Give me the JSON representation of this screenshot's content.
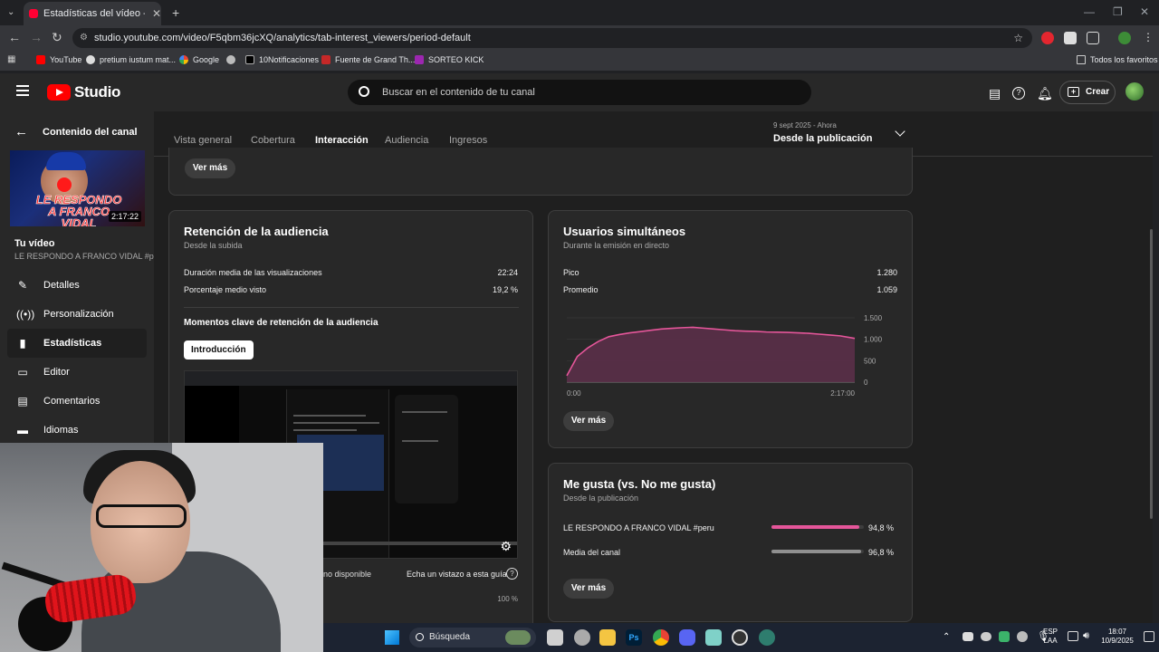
{
  "browser": {
    "tab_title": "Estadísticas del vídeo - YouTube",
    "url": "studio.youtube.com/video/F5qbm36jcXQ/analytics/tab-interest_viewers/period-default",
    "bookmarks": [
      "YouTube",
      "pretium iustum mat...",
      "Google",
      "10Notificaciones",
      "Fuente de Grand Th...",
      "SORTEO KICK"
    ],
    "all_bookmarks": "Todos los favoritos"
  },
  "header": {
    "logo_text": "Studio",
    "search_placeholder": "Buscar en el contenido de tu canal",
    "create_label": "Crear"
  },
  "sidebar": {
    "back_label": "Contenido del canal",
    "thumb_caption": "LE RESPONDO A FRANCO VIDAL",
    "duration": "2:17:22",
    "your_video": "Tu vídeo",
    "video_title": "LE RESPONDO A FRANCO VIDAL #p...",
    "items": [
      {
        "label": "Detalles",
        "icon": "pencil-icon"
      },
      {
        "label": "Personalización",
        "icon": "broadcast-icon"
      },
      {
        "label": "Estadísticas",
        "icon": "bar-chart-icon"
      },
      {
        "label": "Editor",
        "icon": "editor-icon"
      },
      {
        "label": "Comentarios",
        "icon": "comment-icon"
      },
      {
        "label": "Idiomas",
        "icon": "subtitles-icon"
      }
    ]
  },
  "tabs": [
    "Vista general",
    "Cobertura",
    "Interacción",
    "Audiencia",
    "Ingresos"
  ],
  "period": {
    "date_range": "9 sept 2025 - Ahora",
    "label": "Desde la publicación"
  },
  "top_card": {
    "more": "Ver más"
  },
  "retention": {
    "title": "Retención de la audiencia",
    "subtitle": "Desde la subida",
    "avg_duration_label": "Duración media de las visualizaciones",
    "avg_duration_value": "22:24",
    "avg_pct_label": "Porcentaje medio visto",
    "avg_pct_value": "19,2 %",
    "moments_title": "Momentos clave de retención de la audiencia",
    "intro_chip": "Introducción",
    "unavailable": "no disponible",
    "guide_link": "Echa un vistazo a esta guía",
    "pct_tick": "100 %"
  },
  "concurrent": {
    "title": "Usuarios simultáneos",
    "subtitle": "Durante la emisión en directo",
    "peak_label": "Pico",
    "peak_value": "1.280",
    "avg_label": "Promedio",
    "avg_value": "1.059",
    "more": "Ver más",
    "chart_data": {
      "type": "area",
      "y_ticks": [
        "1.500",
        "1.000",
        "500",
        "0"
      ],
      "x_ticks": [
        "0:00",
        "2:17:00"
      ],
      "ylim": [
        0,
        1500
      ],
      "x_minutes": [
        0,
        5,
        10,
        15,
        20,
        25,
        30,
        35,
        40,
        45,
        50,
        55,
        60,
        65,
        70,
        75,
        80,
        85,
        90,
        95,
        100,
        105,
        110,
        115,
        120,
        125,
        130,
        137
      ],
      "values": [
        150,
        600,
        800,
        950,
        1060,
        1110,
        1150,
        1180,
        1210,
        1240,
        1255,
        1270,
        1280,
        1260,
        1240,
        1220,
        1200,
        1190,
        1185,
        1170,
        1165,
        1160,
        1150,
        1140,
        1120,
        1100,
        1080,
        1020
      ]
    }
  },
  "likes": {
    "title": "Me gusta (vs. No me gusta)",
    "subtitle": "Desde la publicación",
    "rows": [
      {
        "label": "LE RESPONDO A FRANCO VIDAL #peru",
        "pct": 94.8,
        "value": "94,8 %",
        "color": "#e5569a"
      },
      {
        "label": "Media del canal",
        "pct": 96.8,
        "value": "96,8 %",
        "color": "#909090"
      }
    ],
    "more": "Ver más"
  },
  "taskbar": {
    "search": "Búsqueda",
    "lang": "ESP",
    "lang2": "LAA",
    "time": "18:07",
    "date": "10/9/2025"
  }
}
